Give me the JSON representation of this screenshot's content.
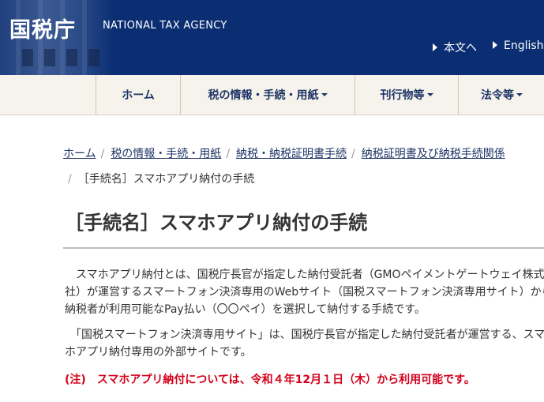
{
  "header": {
    "logo": "国税庁",
    "agency_name": "NATIONAL TAX AGENCY",
    "links": {
      "main_text": "本文へ",
      "english": "English"
    }
  },
  "nav": {
    "items": [
      {
        "label": "ホーム"
      },
      {
        "label": "税の情報・手続・用紙"
      },
      {
        "label": "刊行物等"
      },
      {
        "label": "法令等"
      }
    ]
  },
  "breadcrumb": {
    "items": [
      "ホーム",
      "税の情報・手続・用紙",
      "納税・納税証明書手続",
      "納税証明書及び納税手続関係"
    ],
    "current": "［手続名］スマホアプリ納付の手続"
  },
  "page": {
    "title": "［手続名］スマホアプリ納付の手続",
    "paragraphs": [
      "　スマホアプリ納付とは、国税庁長官が指定した納付受託者（GMOペイメントゲートウェイ株式会",
      "社）が運営するスマートフォン決済専用のWebサイト（国税スマートフォン決済専用サイト）から、",
      "納税者が利用可能なPay払い（〇〇ペイ）を選択して納付する手続です。",
      "　「国税スマートフォン決済専用サイト」は、国税庁長官が指定した納付受託者が運営する、スマ",
      "ホアプリ納付専用の外部サイトです。"
    ],
    "note": "(注)　スマホアプリ納付については、令和４年12月１日（木）から利用可能です。"
  },
  "colors": {
    "header_bg": "#0b2e72",
    "nav_bg": "#f6f2ec",
    "link": "#1e3566",
    "note": "#d4001a"
  }
}
